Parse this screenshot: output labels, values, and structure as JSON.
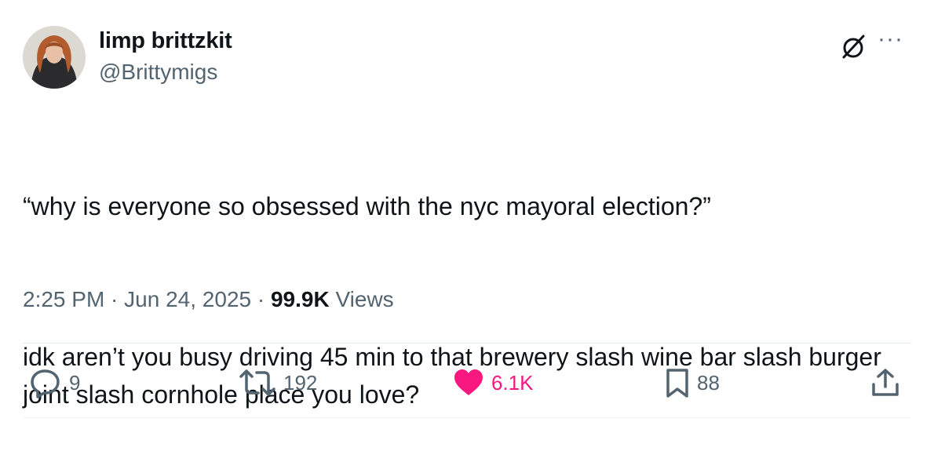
{
  "author": {
    "name": "limp brittzkit",
    "handle": "@Brittymigs"
  },
  "post": {
    "paragraphs": [
      "“why is everyone so obsessed with the nyc mayoral election?”",
      "idk aren’t you busy driving 45 min to that brewery slash wine bar slash burger joint slash cornhole place you love?"
    ],
    "time": "2:25 PM",
    "sep1": " · ",
    "date": "Jun 24, 2025",
    "sep2": " · ",
    "views_count": "99.9K",
    "views_label": " Views"
  },
  "actions": {
    "replies": "9",
    "reposts": "192",
    "likes": "6.1K",
    "bookmarks": "88"
  },
  "icons": {
    "reply": "reply-icon",
    "repost": "repost-icon",
    "like": "heart-icon",
    "bookmark": "bookmark-icon",
    "share": "share-icon",
    "grok": "grok-icon",
    "more": "more-icon"
  },
  "colors": {
    "text": "#0f1419",
    "muted": "#536471",
    "like": "#f91880"
  }
}
